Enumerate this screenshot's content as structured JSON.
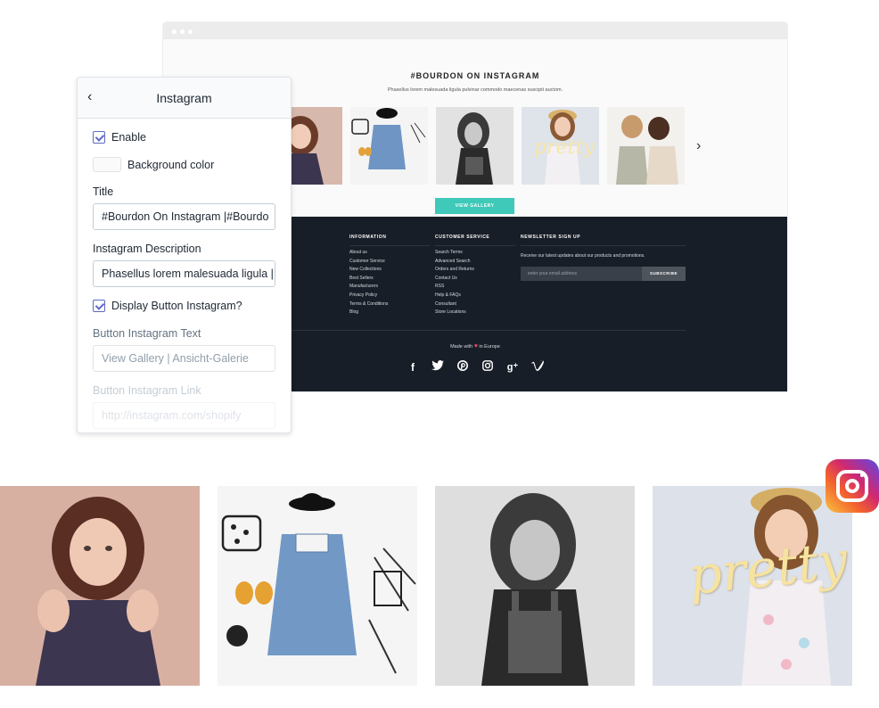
{
  "panel": {
    "title": "Instagram",
    "enable_label": "Enable",
    "bg_color_label": "Background color",
    "title_label": "Title",
    "title_value": "#Bourdon On Instagram |#Bourdo",
    "desc_label": "Instagram Description",
    "desc_value": "Phasellus lorem malesuada ligula |",
    "display_btn_label": "Display Button Instagram?",
    "btn_text_label": "Button Instagram Text",
    "btn_text_value": "View Gallery | Ansicht-Galerie",
    "btn_link_label": "Button Instagram Link",
    "btn_link_value": "http://instagram.com/shopify"
  },
  "store": {
    "insta_title": "#BOURDON ON INSTAGRAM",
    "insta_desc": "Phasellus lorem malesuada ligula pulvinar commodo maecenas suscipit auctom.",
    "gallery_btn": "VIEW GALLERY",
    "photo_texts": {
      "pretty": "pretty"
    },
    "footer": {
      "information": {
        "heading": "INFORMATION",
        "links": [
          "About us",
          "Customer Service",
          "New Collections",
          "Best Sellers",
          "Manufacturers",
          "Privacy Policy",
          "Terms & Conditions",
          "Blog"
        ]
      },
      "customer_service": {
        "heading": "CUSTOMER SERVICE",
        "links": [
          "Search Terms",
          "Advanced Search",
          "Orders and Returns",
          "Contact Us",
          "RSS",
          "Help & FAQs",
          "Consultant",
          "Store Locations"
        ]
      },
      "newsletter": {
        "heading": "NEWSLETTER SIGN UP",
        "text": "Receive our latest updates about our products and promotions.",
        "placeholder": "enter your email address",
        "button": "SUBSCRIBE"
      },
      "made_with_prefix": "Made with",
      "made_with_suffix": "in Europe"
    }
  },
  "colors": {
    "accent": "#3ec9b8",
    "footer_bg": "#181e27",
    "checkbox": "#5c6ac4",
    "heart": "#e74c6f"
  },
  "icons": [
    "back-chevron-icon",
    "next-arrow-icon",
    "facebook-icon",
    "twitter-icon",
    "pinterest-icon",
    "instagram-icon",
    "google-plus-icon",
    "vimeo-icon",
    "heart-icon",
    "instagram-logo-icon"
  ]
}
